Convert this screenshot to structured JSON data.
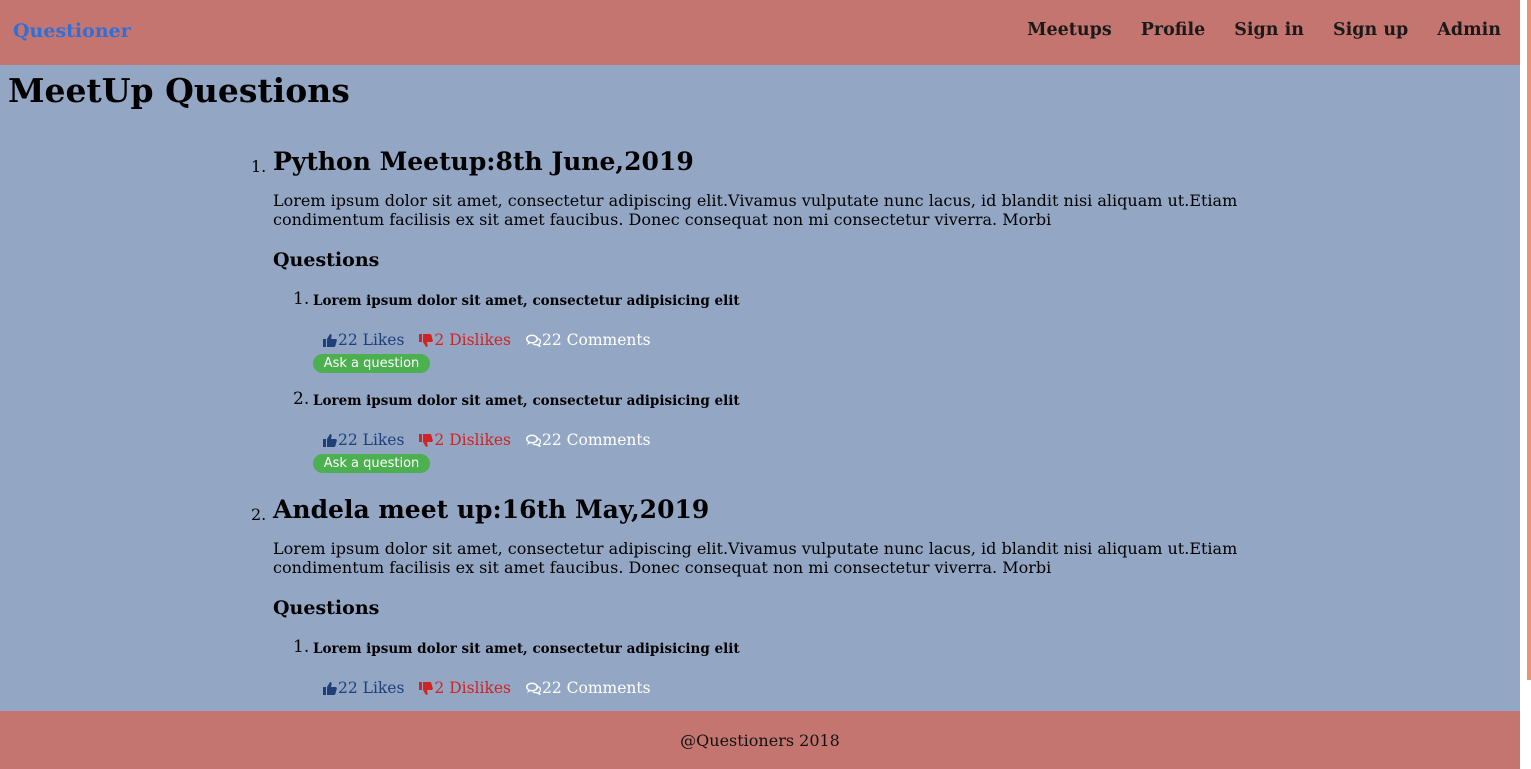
{
  "header": {
    "brand": "Questioner",
    "nav": [
      "Meetups",
      "Profile",
      "Sign in",
      "Sign up",
      "Admin"
    ]
  },
  "page": {
    "title": "MeetUp Questions"
  },
  "meetups": [
    {
      "number": "1.",
      "title": "Python Meetup:8th June,2019",
      "description": "Lorem ipsum dolor sit amet, consectetur adipiscing elit.Vivamus vulputate nunc lacus, id blandit nisi aliquam ut.Etiam condimentum facilisis ex sit amet faucibus. Donec consequat non mi consectetur viverra. Morbi",
      "questions_heading": "Questions",
      "questions": [
        {
          "number": "1.",
          "text": "Lorem ipsum dolor sit amet, consectetur adipisicing elit",
          "likes": "22 Likes",
          "dislikes": "2 Dislikes",
          "comments": "22 Comments",
          "ask_label": "Ask a question"
        },
        {
          "number": "2.",
          "text": "Lorem ipsum dolor sit amet, consectetur adipisicing elit",
          "likes": "22 Likes",
          "dislikes": "2 Dislikes",
          "comments": "22 Comments",
          "ask_label": "Ask a question"
        }
      ]
    },
    {
      "number": "2.",
      "title": "Andela meet up:16th May,2019",
      "description": "Lorem ipsum dolor sit amet, consectetur adipiscing elit.Vivamus vulputate nunc lacus, id blandit nisi aliquam ut.Etiam condimentum facilisis ex sit amet faucibus. Donec consequat non mi consectetur viverra. Morbi",
      "questions_heading": "Questions",
      "questions": [
        {
          "number": "1.",
          "text": "Lorem ipsum dolor sit amet, consectetur adipisicing elit",
          "likes": "22 Likes",
          "dislikes": "2 Dislikes",
          "comments": "22 Comments"
        }
      ]
    }
  ],
  "footer": {
    "text": "@Questioners 2018"
  },
  "colors": {
    "header_bg": "#c57570",
    "content_bg": "#93a7c5",
    "brand": "#2f6fd8",
    "likes": "#1e3f7a",
    "dislikes": "#d02323",
    "comments": "#ffffff",
    "ask_button": "#4caf50"
  },
  "icons": {
    "likes": "thumbs-up-icon",
    "dislikes": "thumbs-down-icon",
    "comments": "comments-icon"
  }
}
